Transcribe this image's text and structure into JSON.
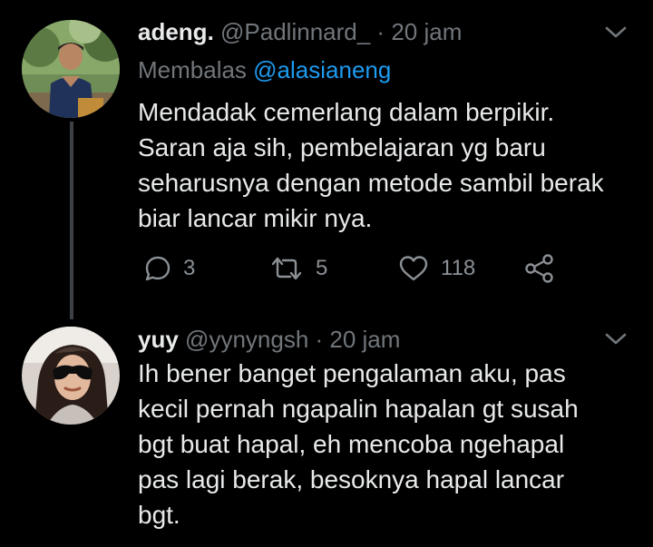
{
  "tweets": [
    {
      "display_name": "adeng.",
      "handle": "@Padlinnard_",
      "separator": " · ",
      "time": "20 jam",
      "reply_prefix": "Membalas ",
      "reply_to": "@alasianeng",
      "text": "Mendadak cemerlang dalam berpikir.\nSaran aja sih, pembelajaran yg baru\nseharusnya dengan metode sambil berak\nbiar lancar mikir nya.",
      "stats": {
        "replies": "3",
        "retweets": "5",
        "likes": "118"
      },
      "icons": {
        "reply": "reply-icon",
        "retweet": "retweet-icon",
        "like": "heart-icon",
        "share": "share-icon",
        "menu": "chevron-down-icon"
      }
    },
    {
      "display_name": "yuy",
      "handle": "@yynyngsh",
      "separator": " · ",
      "time": "20 jam",
      "text": "Ih bener banget pengalaman aku, pas\nkecil pernah ngapalin hapalan gt susah\nbgt buat hapal, eh mencoba ngehapal\npas lagi berak, besoknya hapal lancar\nbgt."
    }
  ],
  "colors": {
    "background": "#000000",
    "text": "#e7e9ea",
    "muted": "#71767b",
    "link": "#1d9bf0",
    "thread_line": "#3d4145"
  }
}
